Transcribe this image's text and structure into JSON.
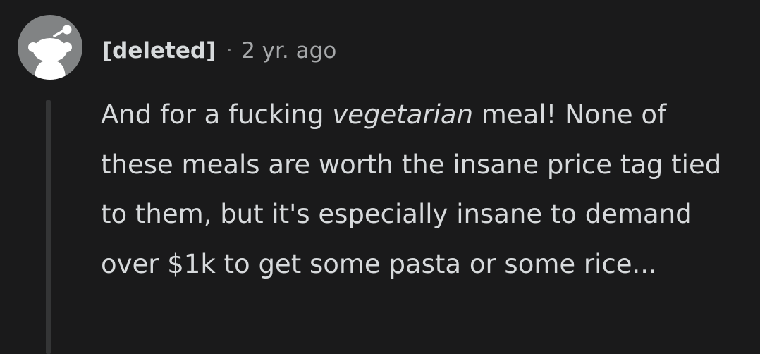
{
  "comment": {
    "author": "[deleted]",
    "separator": "·",
    "timestamp": "2 yr. ago",
    "avatar_icon": "reddit-snoo-default-avatar",
    "body": {
      "before_emphasis": "And for a fucking ",
      "emphasis": "vegetarian",
      "after_emphasis": " meal! None of these meals are worth the insane price tag tied to them, but it's especially insane to demand over $1k to get some pasta or some rice..."
    }
  },
  "colors": {
    "background": "#1a1a1b",
    "text": "#d7dadc",
    "muted": "#818384",
    "avatar_bg": "#818384",
    "thread_line": "#343536"
  }
}
